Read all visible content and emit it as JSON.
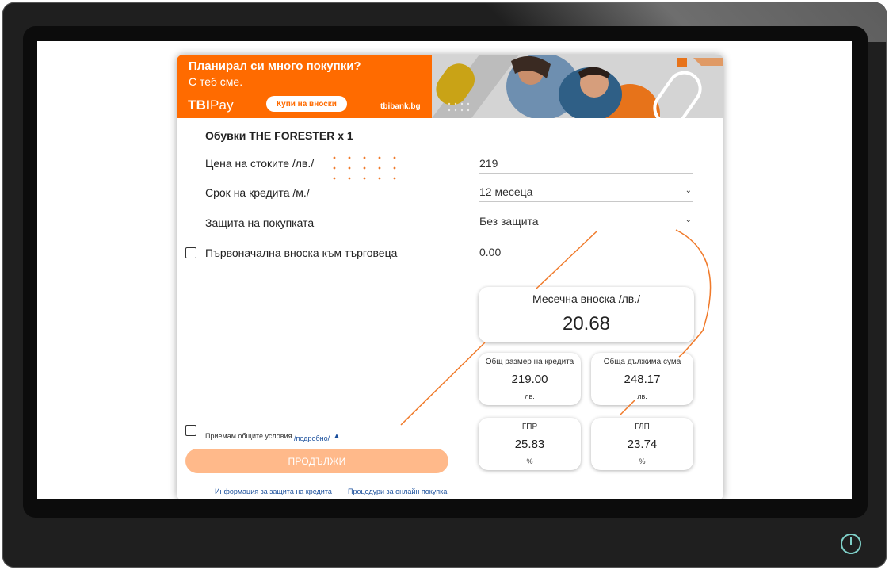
{
  "banner": {
    "title": "Планирал си много покупки?",
    "subtitle": "С теб сме.",
    "brand_tbi": "TBI",
    "brand_pay": "Pay",
    "buy_button": "Купи на вноски",
    "site": "tbibank.bg"
  },
  "product": {
    "title": "Обувки THE FORESTER x 1"
  },
  "form": {
    "price_label": "Цена на стоките /лв./",
    "price_value": "219",
    "term_label": "Срок на кредита /м./",
    "term_value": "12 месеца",
    "protection_label": "Защита на покупката",
    "protection_value": "Без защита",
    "downpayment_label": "Първоначална вноска към търговеца",
    "downpayment_value": "0.00"
  },
  "results": {
    "monthly_label": "Месечна вноска /лв./",
    "monthly_value": "20.68",
    "total_credit_label": "Общ размер на кредита",
    "total_credit_value": "219.00",
    "total_credit_unit": "лв.",
    "total_due_label": "Обща дължима сума",
    "total_due_value": "248.17",
    "total_due_unit": "лв.",
    "gpr_label": "ГПР",
    "gpr_value": "25.83",
    "gpr_unit": "%",
    "glp_label": "ГЛП",
    "glp_value": "23.74",
    "glp_unit": "%"
  },
  "terms": {
    "text": "Приемам общите условия",
    "link": "/подробно/",
    "arrow": "▲"
  },
  "actions": {
    "continue": "ПРОДЪЛЖИ"
  },
  "footer": {
    "link_protection": "Информация за защита на кредита",
    "link_procedures": "Процедури за онлайн покупка"
  },
  "colors": {
    "accent": "#ff6b00",
    "continue_bg": "#ffb98a",
    "link": "#1a4f9c"
  }
}
